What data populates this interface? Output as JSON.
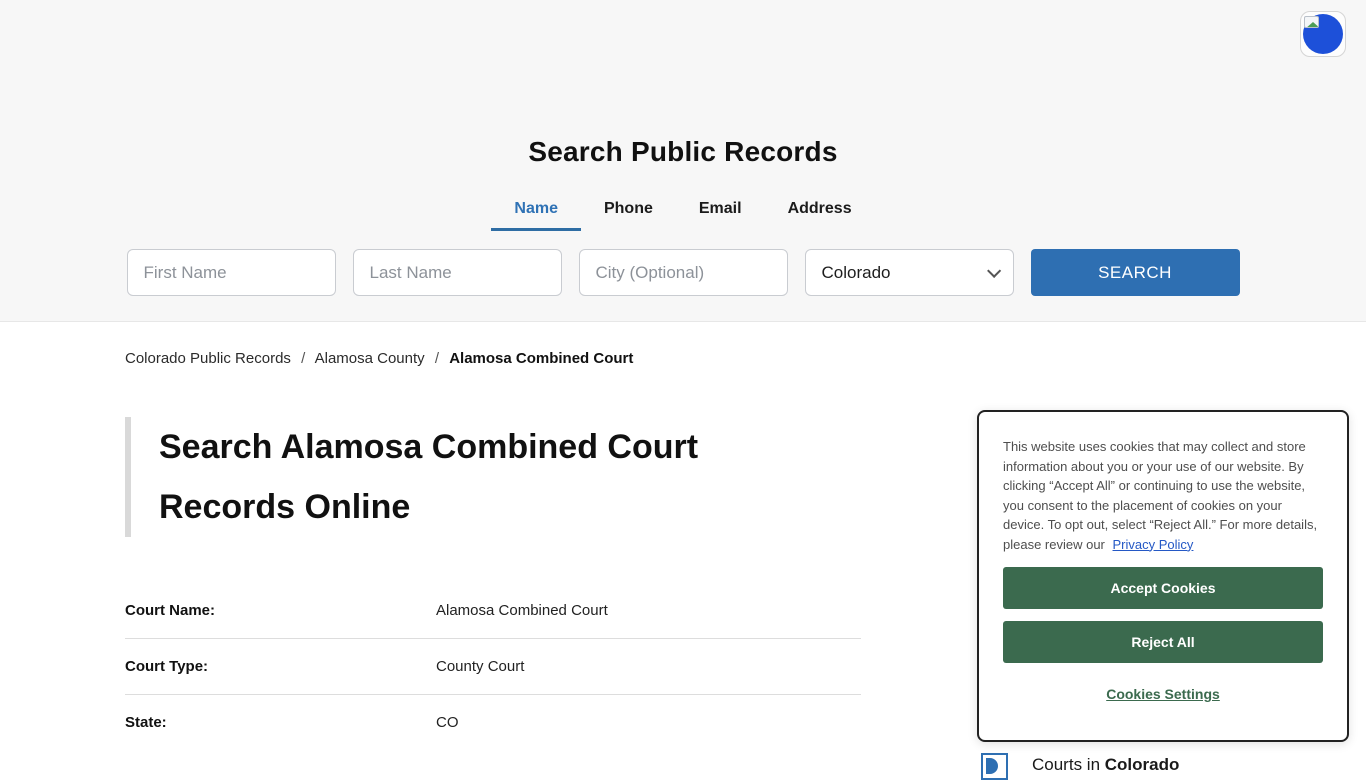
{
  "search_panel": {
    "title": "Search Public Records",
    "tabs": [
      {
        "label": "Name",
        "active": true
      },
      {
        "label": "Phone",
        "active": false
      },
      {
        "label": "Email",
        "active": false
      },
      {
        "label": "Address",
        "active": false
      }
    ],
    "first_name_placeholder": "First Name",
    "last_name_placeholder": "Last Name",
    "city_placeholder": "City (Optional)",
    "state_selected": "Colorado",
    "search_button": "SEARCH"
  },
  "breadcrumb": {
    "items": [
      "Colorado Public Records",
      "Alamosa County",
      "Alamosa Combined Court"
    ],
    "separator": "/"
  },
  "main": {
    "heading": "Search Alamosa Combined Court Records Online",
    "details": [
      {
        "label": "Court Name:",
        "value": "Alamosa Combined Court"
      },
      {
        "label": "Court Type:",
        "value": "County Court"
      },
      {
        "label": "State:",
        "value": "CO"
      }
    ]
  },
  "related": {
    "prefix": "Courts in ",
    "bold": "Colorado"
  },
  "cookie_dialog": {
    "message": "This website uses cookies that may collect and store information about you or your use of our website. By clicking “Accept All” or continuing to use the website, you consent to the placement of cookies on your device. To opt out, select “Reject All.” For more details, please review our",
    "privacy_link": "Privacy Policy",
    "accept_button": "Accept Cookies",
    "reject_button": "Reject All",
    "settings_link": "Cookies Settings"
  },
  "colors": {
    "accent_blue": "#2e6fb2",
    "active_tab_blue": "#2f72b5",
    "cookie_green": "#3b6a4e",
    "link_blue": "#2458c5",
    "widget_blue": "#1d50d9"
  }
}
